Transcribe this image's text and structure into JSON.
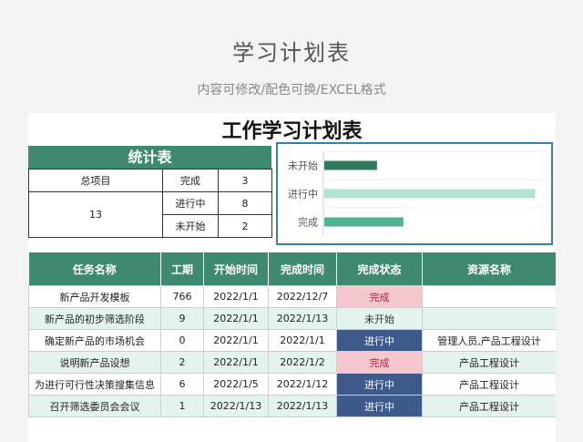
{
  "header": {
    "title": "学习计划表",
    "subtitle": "内容可修改/配色可换/EXCEL格式"
  },
  "sheet": {
    "title": "工作学习计划表",
    "stats": {
      "heading": "统计表",
      "total_label": "总项目",
      "total_value": "13",
      "rows": [
        {
          "label": "完成",
          "value": "3"
        },
        {
          "label": "进行中",
          "value": "8"
        },
        {
          "label": "未开始",
          "value": "2"
        }
      ]
    },
    "colors": {
      "header_green": "#3f8a6e",
      "done_bg": "#f7c7cf",
      "progress_bg": "#3e5a8a",
      "bar_not_started": "#2e7b5c",
      "bar_in_progress": "#b3e2d3",
      "bar_done": "#4bb38d"
    },
    "table": {
      "columns": [
        "任务名称",
        "工期",
        "开始时间",
        "完成时间",
        "完成状态",
        "资源名称"
      ],
      "rows": [
        {
          "name": "新产品开发模板",
          "duration": "766",
          "start": "2022/1/1",
          "end": "2022/12/7",
          "status": "完成",
          "resource": ""
        },
        {
          "name": "新产品的初步筛选阶段",
          "duration": "9",
          "start": "2022/1/1",
          "end": "2022/1/13",
          "status": "未开始",
          "resource": ""
        },
        {
          "name": "确定新产品的市场机会",
          "duration": "0",
          "start": "2022/1/1",
          "end": "2022/1/1",
          "status": "进行中",
          "resource": "管理人员,产品工程设计"
        },
        {
          "name": "说明新产品设想",
          "duration": "2",
          "start": "2022/1/1",
          "end": "2022/1/2",
          "status": "完成",
          "resource": "产品工程设计"
        },
        {
          "name": "为进行可行性决策搜集信息",
          "duration": "6",
          "start": "2022/1/5",
          "end": "2022/1/12",
          "status": "进行中",
          "resource": "产品工程设计"
        },
        {
          "name": "召开筛选委员会会议",
          "duration": "1",
          "start": "2022/1/13",
          "end": "2022/1/13",
          "status": "进行中",
          "resource": "产品工程设计"
        }
      ]
    }
  },
  "chart_data": {
    "type": "bar",
    "orientation": "horizontal",
    "categories": [
      "未开始",
      "进行中",
      "完成"
    ],
    "values": [
      2,
      8,
      3
    ],
    "xlim": [
      0,
      8.5
    ],
    "grid": true
  }
}
